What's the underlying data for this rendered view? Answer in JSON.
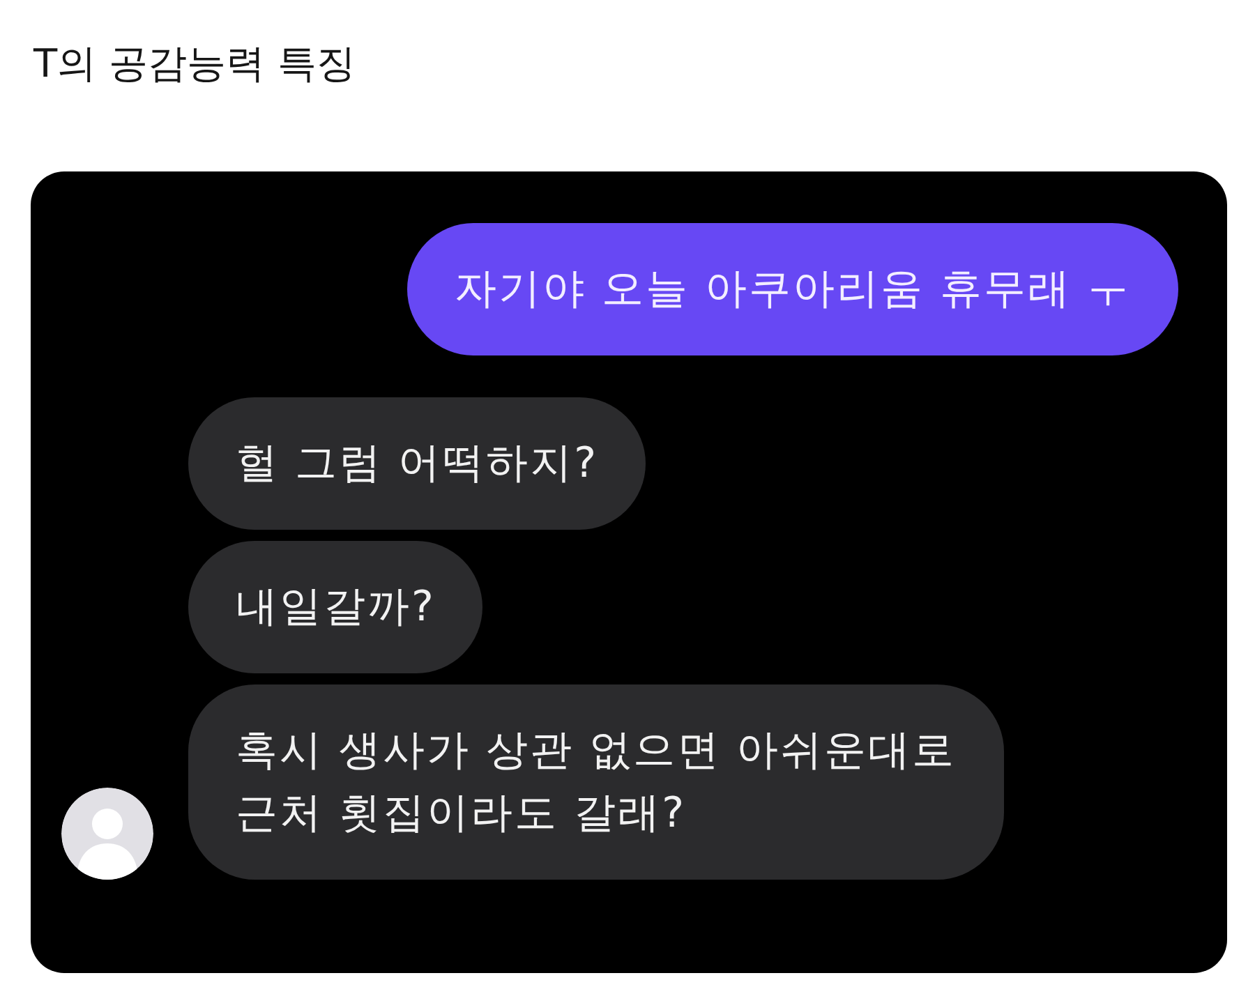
{
  "title": "T의 공감능력 특징",
  "chat": {
    "messages": [
      {
        "kind": "sent",
        "text": "자기야 오늘 아쿠아리움 휴무래 ㅜ",
        "show_avatar": false
      },
      {
        "kind": "received",
        "text": "헐 그럼 어떡하지?",
        "show_avatar": false
      },
      {
        "kind": "received",
        "text": "내일갈까?",
        "show_avatar": false
      },
      {
        "kind": "received",
        "text": "혹시 생사가 상관 없으면 아쉬운대로\n근처 횟집이라도 갈래?",
        "show_avatar": true
      }
    ]
  }
}
